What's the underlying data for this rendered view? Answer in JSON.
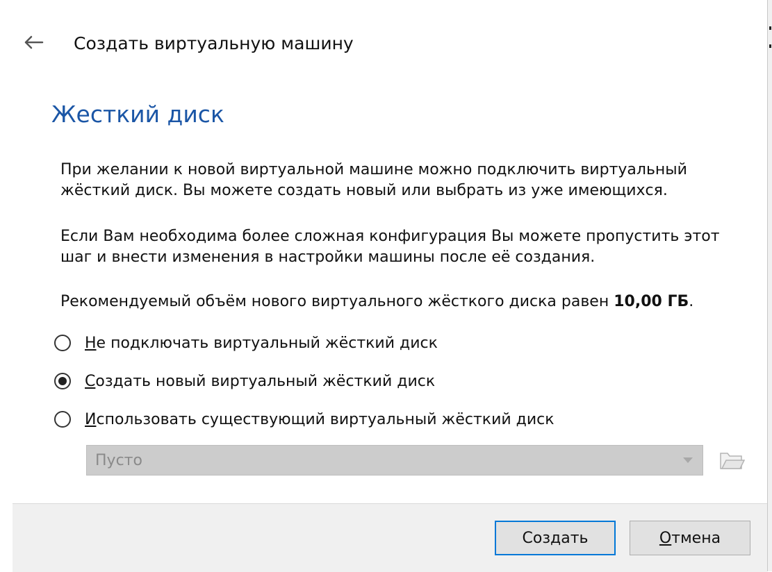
{
  "window": {
    "title": "Создать виртуальную машину"
  },
  "page": {
    "heading": "Жесткий диск",
    "paragraph1_line1": "При желании к новой виртуальной машине можно подключить виртуальный",
    "paragraph1_line2": "жёсткий диск. Вы можете создать новый или выбрать из уже имеющихся.",
    "paragraph2_line1": "Если Вам необходима более сложная конфигурация Вы можете пропустить этот",
    "paragraph2_line2": "шаг и внести изменения в настройки машины после её создания.",
    "recommended_prefix": "Рекомендуемый объём нового виртуального жёсткого диска равен ",
    "recommended_size": "10,00 ГБ",
    "recommended_suffix": "."
  },
  "options": [
    {
      "accel": "Н",
      "rest": "е подключать виртуальный жёсткий диск",
      "selected": false
    },
    {
      "accel": "С",
      "rest": "оздать новый виртуальный жёсткий диск",
      "selected": true
    },
    {
      "accel": "И",
      "rest": "спользовать существующий виртуальный жёсткий диск",
      "selected": false
    }
  ],
  "existing_disk": {
    "value": "Пусто",
    "enabled": false
  },
  "buttons": {
    "create": "Создать",
    "cancel_accel": "О",
    "cancel_rest": "тмена"
  },
  "icons": {
    "back": "back-arrow-icon",
    "dropdown": "chevron-down-icon",
    "folder": "folder-open-icon"
  },
  "colors": {
    "heading": "#1b56a6",
    "default_button_border": "#0078d7",
    "footer_bg": "#f0f0f0",
    "disabled_combo_bg": "#cccccc"
  }
}
